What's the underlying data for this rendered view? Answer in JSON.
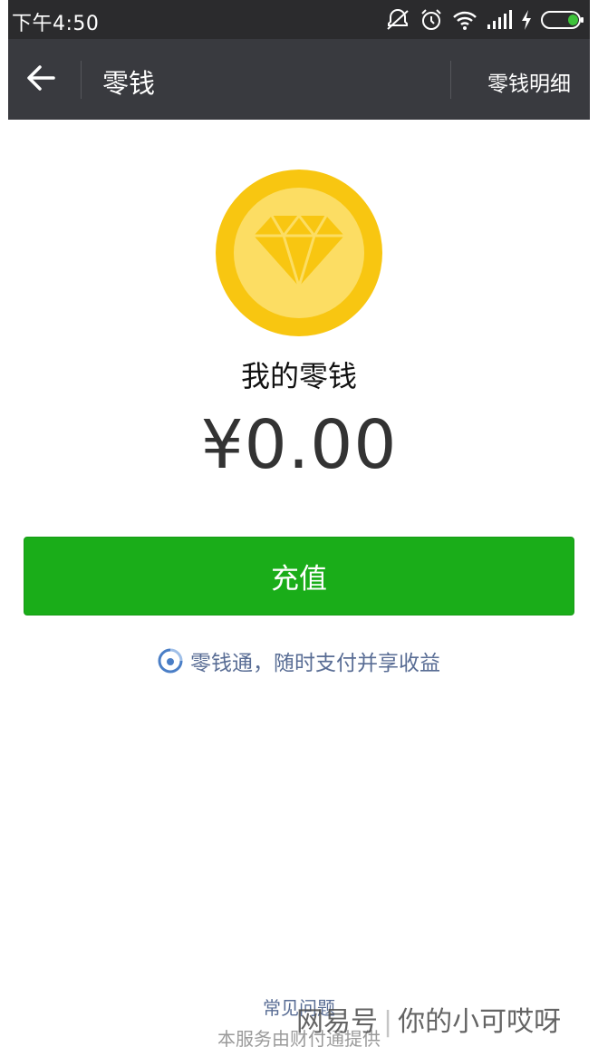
{
  "status_bar": {
    "time": "下午4:50",
    "icons": [
      "mute-icon",
      "alarm-icon",
      "wifi-icon",
      "signal-icon",
      "charging-icon",
      "battery-icon"
    ],
    "battery_color": "#3ec23a"
  },
  "nav": {
    "title": "零钱",
    "detail_link": "零钱明细",
    "back_icon": "arrow-left-icon"
  },
  "wallet": {
    "icon": "diamond-coin-icon",
    "label": "我的零钱",
    "amount": "¥0.00"
  },
  "actions": {
    "recharge_label": "充值",
    "lqt_icon": "lingqiantong-icon",
    "lqt_text": "零钱通，随时支付并享收益"
  },
  "footer": {
    "faq": "常见问题",
    "note": "本服务由财付通提供"
  },
  "watermark": {
    "source": "网易号",
    "author": "你的小可哎呀"
  },
  "colors": {
    "nav_bg": "#393a3f",
    "status_bg": "#2b2b2d",
    "primary_green": "#1aad19",
    "link_blue": "#586c94",
    "coin_outer": "#f8c611",
    "coin_inner": "#fcdd63"
  }
}
